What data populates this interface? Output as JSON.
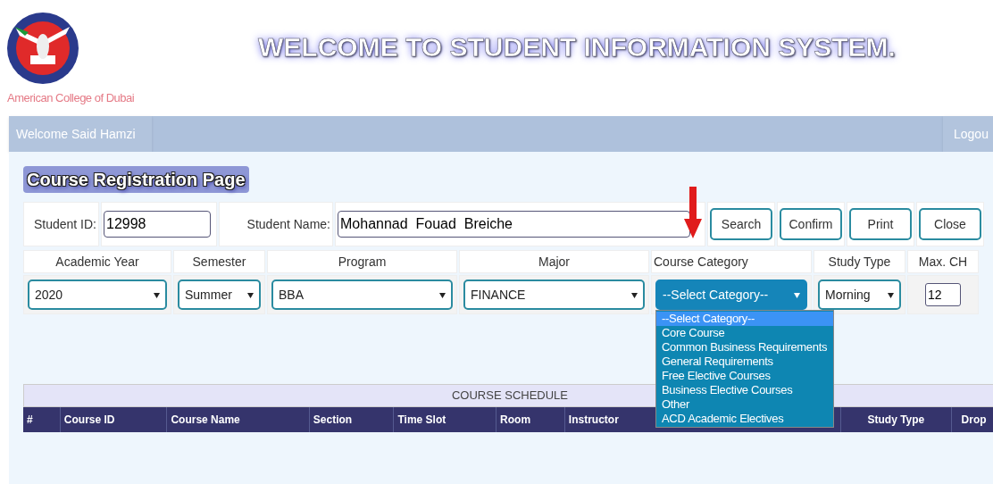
{
  "header": {
    "title": "WELCOME TO STUDENT INFORMATION SYSTEM.",
    "college": "American College of Dubai"
  },
  "nav": {
    "welcome": "Welcome Said Hamzi",
    "logout": "Logou"
  },
  "page_title": "Course Registration Page",
  "student": {
    "id_label": "Student ID:",
    "id_value": "12998",
    "name_label": "Student Name:",
    "name_value": "Mohannad  Fouad  Breiche"
  },
  "buttons": [
    "Search",
    "Confirm",
    "Print",
    "Close"
  ],
  "filters": [
    {
      "label": "Academic Year",
      "kind": "select",
      "value": "2020",
      "focused": false
    },
    {
      "label": "Semester",
      "kind": "select",
      "value": "Summer",
      "focused": false
    },
    {
      "label": "Program",
      "kind": "select",
      "value": "BBA",
      "focused": false
    },
    {
      "label": "Major",
      "kind": "select",
      "value": "FINANCE",
      "focused": false
    },
    {
      "label": "Course Category",
      "kind": "select",
      "value": "--Select Category--",
      "focused": true
    },
    {
      "label": "Study Type",
      "kind": "select",
      "value": "Morning",
      "focused": false
    },
    {
      "label": "Max. CH",
      "kind": "input",
      "value": "12",
      "focused": false
    }
  ],
  "category_options": [
    {
      "label": "--Select Category--",
      "selected": true
    },
    {
      "label": "Core Course",
      "selected": false
    },
    {
      "label": "Common Business Requirements",
      "selected": false
    },
    {
      "label": "General Requirements",
      "selected": false
    },
    {
      "label": "Free Elective Courses",
      "selected": false
    },
    {
      "label": "Business Elective Courses",
      "selected": false
    },
    {
      "label": "Other",
      "selected": false
    },
    {
      "label": "ACD Academic Electives",
      "selected": false
    }
  ],
  "schedule": {
    "title": "COURSE SCHEDULE",
    "columns": [
      "#",
      "Course ID",
      "Course Name",
      "Section",
      "Time Slot",
      "Room",
      "Instructor",
      "Study Type",
      "Drop"
    ]
  }
}
